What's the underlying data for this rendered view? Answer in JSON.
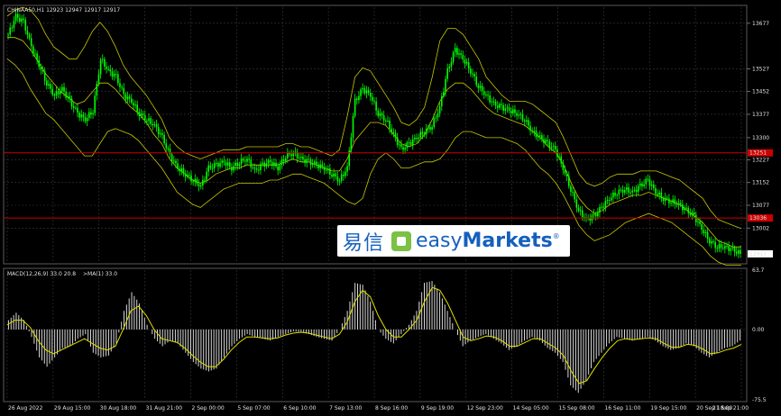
{
  "header": {
    "main_info": "CHINAA50,H1  12923 12947 12917 12917",
    "macd_info": "MACD(12,26,9) 33.0 20.8",
    "ma_info": ">MA(1) 33.0"
  },
  "logo": {
    "cn": "易信",
    "en_light": "easy",
    "en_bold": "Markets",
    "reg": "®"
  },
  "colors": {
    "background": "#000000",
    "grid": "#3a3a3a",
    "candle": "#00ff00",
    "bands": "#c8c800",
    "hline": "#cc0000",
    "price_tag": "#cc0000",
    "macd_hist": "#d8d8d8",
    "macd_signal": "#e0e000",
    "logo_blue": "#1560bd",
    "logo_green": "#7bc142"
  },
  "chart_data": [
    {
      "type": "candlestick",
      "symbol": "CHINAA50",
      "timeframe": "H1",
      "ylim": [
        12890,
        13730
      ],
      "yticks": [
        "13677",
        "13527",
        "13452",
        "13377",
        "13300",
        "13227",
        "13152",
        "13077",
        "13002"
      ],
      "ytick_values": [
        13677,
        13527,
        13452,
        13377,
        13300,
        13227,
        13152,
        13077,
        13002
      ],
      "hlines": [
        13250,
        13035
      ],
      "hline_labels": [
        "13251",
        "13036"
      ],
      "last_price": "12917",
      "last_price_value": 12917,
      "x_labels": [
        "26 Aug 2022",
        "29 Aug 15:00",
        "30 Aug 18:00",
        "31 Aug 21:00",
        "2 Sep 00:00",
        "5 Sep 07:00",
        "6 Sep 10:00",
        "7 Sep 13:00",
        "8 Sep 16:00",
        "9 Sep 19:00",
        "12 Sep 23:00",
        "14 Sep 05:00",
        "15 Sep 08:00",
        "16 Sep 11:00",
        "19 Sep 15:00",
        "20 Sep 18:00",
        "21 Sep 21:00"
      ],
      "close_path": [
        13640,
        13700,
        13680,
        13600,
        13540,
        13480,
        13440,
        13460,
        13420,
        13380,
        13360,
        13390,
        13560,
        13520,
        13500,
        13440,
        13420,
        13380,
        13360,
        13340,
        13300,
        13240,
        13200,
        13180,
        13160,
        13140,
        13200,
        13210,
        13220,
        13200,
        13220,
        13230,
        13190,
        13210,
        13220,
        13200,
        13240,
        13250,
        13230,
        13220,
        13210,
        13200,
        13180,
        13160,
        13200,
        13420,
        13460,
        13440,
        13380,
        13360,
        13310,
        13260,
        13280,
        13300,
        13320,
        13340,
        13400,
        13520,
        13590,
        13560,
        13520,
        13470,
        13440,
        13410,
        13400,
        13390,
        13380,
        13360,
        13320,
        13300,
        13280,
        13260,
        13200,
        13130,
        13060,
        13030,
        13040,
        13070,
        13100,
        13120,
        13130,
        13120,
        13140,
        13160,
        13120,
        13100,
        13090,
        13080,
        13060,
        13040,
        13000,
        12960,
        12940,
        12940,
        12930,
        12917
      ],
      "bb_upper": [
        13700,
        13720,
        13730,
        13720,
        13690,
        13640,
        13600,
        13580,
        13560,
        13560,
        13600,
        13650,
        13680,
        13650,
        13600,
        13540,
        13500,
        13470,
        13440,
        13400,
        13360,
        13300,
        13270,
        13250,
        13240,
        13230,
        13240,
        13250,
        13260,
        13260,
        13260,
        13270,
        13270,
        13270,
        13270,
        13270,
        13280,
        13280,
        13270,
        13270,
        13260,
        13250,
        13240,
        13260,
        13370,
        13500,
        13530,
        13520,
        13480,
        13440,
        13400,
        13350,
        13340,
        13360,
        13400,
        13500,
        13620,
        13660,
        13660,
        13640,
        13600,
        13560,
        13500,
        13470,
        13440,
        13420,
        13420,
        13420,
        13410,
        13390,
        13370,
        13350,
        13300,
        13240,
        13180,
        13150,
        13140,
        13150,
        13170,
        13180,
        13180,
        13180,
        13190,
        13190,
        13190,
        13180,
        13170,
        13160,
        13140,
        13120,
        13100,
        13060,
        13030,
        13020,
        13010,
        13000
      ],
      "bb_lower": [
        13560,
        13540,
        13510,
        13460,
        13420,
        13380,
        13360,
        13330,
        13300,
        13270,
        13240,
        13240,
        13280,
        13320,
        13330,
        13320,
        13310,
        13290,
        13260,
        13230,
        13200,
        13160,
        13120,
        13100,
        13080,
        13070,
        13090,
        13110,
        13130,
        13140,
        13150,
        13150,
        13150,
        13150,
        13160,
        13160,
        13170,
        13180,
        13180,
        13170,
        13160,
        13150,
        13130,
        13110,
        13090,
        13080,
        13100,
        13180,
        13230,
        13250,
        13230,
        13200,
        13200,
        13210,
        13220,
        13220,
        13230,
        13260,
        13300,
        13320,
        13320,
        13310,
        13300,
        13300,
        13300,
        13290,
        13280,
        13260,
        13230,
        13200,
        13180,
        13150,
        13110,
        13060,
        13010,
        12980,
        12960,
        12970,
        12980,
        13000,
        13020,
        13030,
        13040,
        13050,
        13040,
        13030,
        13020,
        13000,
        12980,
        12960,
        12940,
        12910,
        12890,
        12880,
        12880,
        12880
      ],
      "bb_mid": [
        13630,
        13630,
        13620,
        13590,
        13550,
        13510,
        13480,
        13450,
        13430,
        13410,
        13420,
        13450,
        13480,
        13480,
        13460,
        13430,
        13400,
        13380,
        13350,
        13310,
        13280,
        13230,
        13200,
        13180,
        13160,
        13150,
        13160,
        13180,
        13190,
        13200,
        13200,
        13210,
        13210,
        13210,
        13210,
        13210,
        13220,
        13230,
        13220,
        13220,
        13210,
        13200,
        13190,
        13190,
        13230,
        13290,
        13320,
        13350,
        13350,
        13340,
        13310,
        13280,
        13270,
        13280,
        13310,
        13360,
        13420,
        13460,
        13480,
        13480,
        13460,
        13430,
        13400,
        13380,
        13370,
        13360,
        13350,
        13340,
        13320,
        13300,
        13270,
        13250,
        13210,
        13150,
        13100,
        13070,
        13050,
        13060,
        13080,
        13090,
        13100,
        13110,
        13110,
        13120,
        13110,
        13100,
        13090,
        13080,
        13060,
        13040,
        13020,
        12990,
        12960,
        12950,
        12940,
        12940
      ]
    },
    {
      "type": "macd",
      "params": [
        12,
        26,
        9
      ],
      "ylim": [
        -75.5,
        63.7
      ],
      "yticks": [
        "63.7",
        "0.00",
        "-75.5"
      ],
      "ytick_values": [
        63.7,
        0,
        -75.5
      ],
      "histogram": [
        10,
        18,
        10,
        -8,
        -30,
        -40,
        -30,
        -20,
        -18,
        -10,
        -5,
        -25,
        -30,
        -28,
        -15,
        20,
        40,
        28,
        5,
        -10,
        -18,
        -12,
        -15,
        -25,
        -35,
        -42,
        -45,
        -42,
        -30,
        -18,
        -10,
        -5,
        -8,
        -10,
        -12,
        -8,
        -5,
        -2,
        -3,
        -5,
        -8,
        -10,
        -12,
        0,
        20,
        50,
        48,
        30,
        0,
        -10,
        -15,
        -5,
        5,
        20,
        50,
        52,
        40,
        20,
        0,
        -18,
        -12,
        -8,
        -5,
        -10,
        -15,
        -22,
        -18,
        -12,
        -8,
        -12,
        -20,
        -25,
        -35,
        -60,
        -68,
        -55,
        -35,
        -25,
        -15,
        -8,
        -10,
        -12,
        -10,
        -8,
        -12,
        -18,
        -22,
        -20,
        -15,
        -18,
        -25,
        -30,
        -25,
        -20,
        -18,
        -12
      ],
      "signal": [
        5,
        10,
        10,
        2,
        -12,
        -22,
        -26,
        -22,
        -18,
        -14,
        -10,
        -15,
        -20,
        -22,
        -18,
        0,
        20,
        25,
        15,
        0,
        -10,
        -12,
        -14,
        -20,
        -28,
        -35,
        -40,
        -40,
        -32,
        -22,
        -14,
        -8,
        -8,
        -9,
        -10,
        -9,
        -6,
        -4,
        -3,
        -4,
        -6,
        -8,
        -10,
        -5,
        8,
        30,
        42,
        35,
        15,
        0,
        -8,
        -8,
        0,
        10,
        30,
        45,
        42,
        28,
        10,
        -8,
        -12,
        -10,
        -7,
        -8,
        -12,
        -18,
        -18,
        -14,
        -10,
        -10,
        -15,
        -20,
        -28,
        -45,
        -58,
        -55,
        -42,
        -30,
        -20,
        -12,
        -10,
        -11,
        -10,
        -9,
        -10,
        -15,
        -19,
        -19,
        -16,
        -17,
        -21,
        -26,
        -25,
        -22,
        -20,
        -16
      ]
    }
  ]
}
